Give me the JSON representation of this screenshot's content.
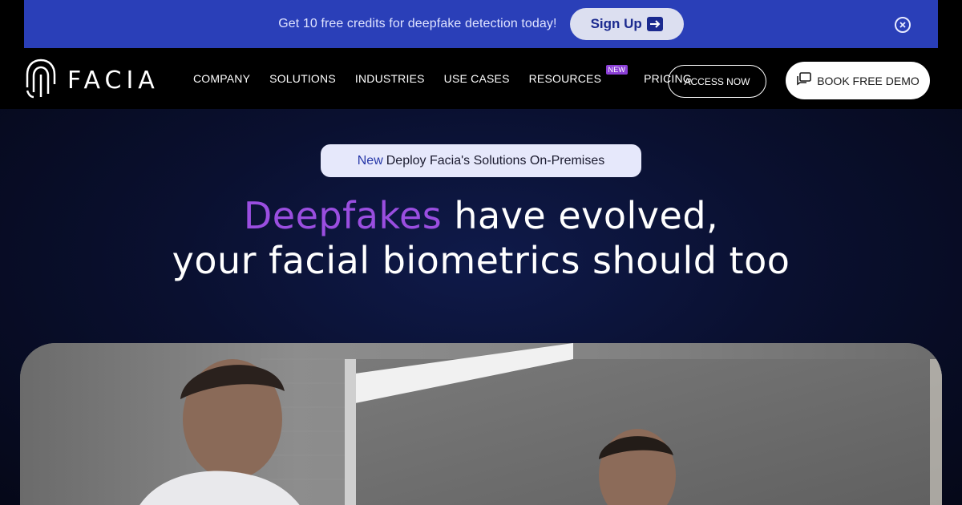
{
  "promo": {
    "text": "Get 10 free credits for deepfake detection today!",
    "button_label": "Sign Up",
    "colors": {
      "background": "#2a3fb8",
      "button_bg": "#dcdff0",
      "button_text": "#1b2a8f"
    }
  },
  "nav": {
    "brand": "FACIA",
    "links": [
      {
        "label": "COMPANY"
      },
      {
        "label": "SOLUTIONS"
      },
      {
        "label": "INDUSTRIES"
      },
      {
        "label": "USE CASES"
      },
      {
        "label": "RESOURCES",
        "badge": "NEW"
      },
      {
        "label": "PRICING"
      }
    ],
    "access_label": "ACCESS NOW",
    "demo_label": "BOOK FREE DEMO"
  },
  "hero": {
    "pill_new": "New",
    "pill_text": "Deploy Facia's Solutions On-Premises",
    "headline_accent": "Deepfakes",
    "headline_line1_rest": " have evolved,",
    "headline_line2": "your facial biometrics should too",
    "accent_color": "#9a4ee0"
  }
}
